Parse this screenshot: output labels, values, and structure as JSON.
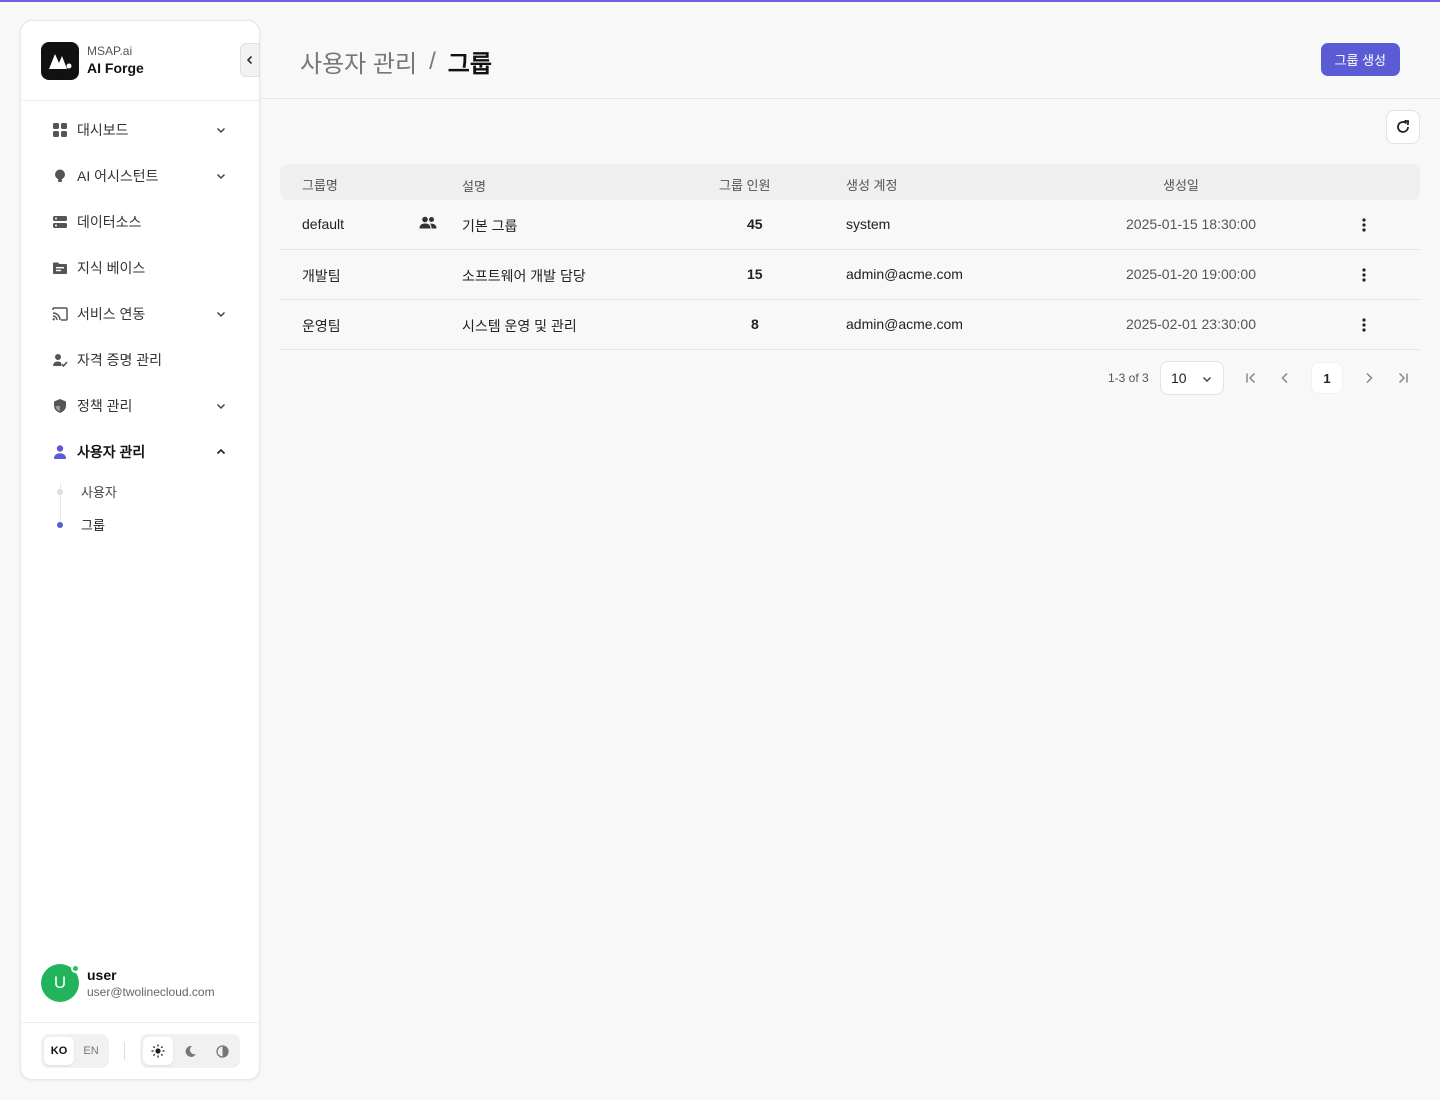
{
  "brand": {
    "sub": "MSAP.ai",
    "name": "AI Forge"
  },
  "nav": {
    "dashboard": "대시보드",
    "ai_assistant": "AI 어시스턴트",
    "datasource": "데이터소스",
    "knowledge_base": "지식 베이스",
    "service_integration": "서비스 연동",
    "credentials": "자격 증명 관리",
    "policy": "정책 관리",
    "user_management": "사용자 관리",
    "sub": {
      "users": "사용자",
      "groups": "그룹"
    }
  },
  "user": {
    "name": "user",
    "email": "user@twolinecloud.com",
    "initial": "U"
  },
  "lang": {
    "ko": "KO",
    "en": "EN"
  },
  "header": {
    "breadcrumb_parent": "사용자 관리",
    "breadcrumb_sep": "/",
    "breadcrumb_current": "그룹",
    "create_button": "그룹 생성"
  },
  "table": {
    "columns": {
      "name": "그룹명",
      "description": "설명",
      "members": "그룹 인원",
      "creator": "생성 계정",
      "created": "생성일"
    },
    "rows": [
      {
        "name": "default",
        "description": "기본 그룹",
        "members": "45",
        "creator": "system",
        "created": "2025-01-15 18:30:00"
      },
      {
        "name": "개발팀",
        "description": "소프트웨어 개발 담당",
        "members": "15",
        "creator": "admin@acme.com",
        "created": "2025-01-20 19:00:00"
      },
      {
        "name": "운영팀",
        "description": "시스템 운영 및 관리",
        "members": "8",
        "creator": "admin@acme.com",
        "created": "2025-02-01 23:30:00"
      }
    ]
  },
  "pagination": {
    "info": "1-3 of 3",
    "page_size": "10",
    "current_page": "1"
  },
  "colors": {
    "accent": "#5b5bd6",
    "avatar": "#22b45a"
  }
}
